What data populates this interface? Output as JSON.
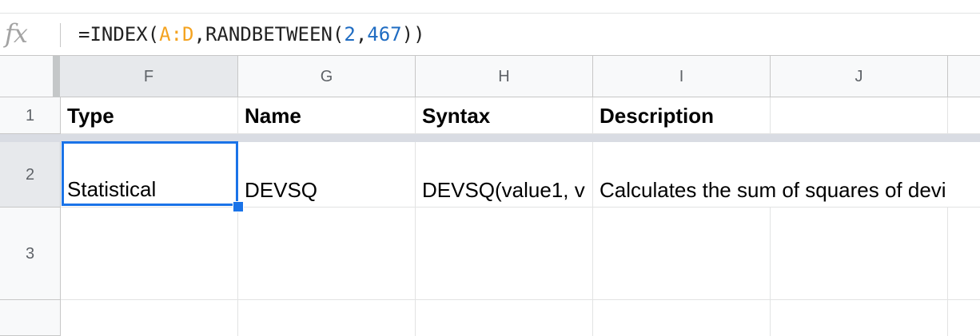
{
  "formula_bar": {
    "fx_label": "fx",
    "formula_prefix": "=INDEX(",
    "formula_range": "A:D",
    "formula_mid": ",RANDBETWEEN(",
    "formula_arg1": "2",
    "formula_comma": ",",
    "formula_arg2": "467",
    "formula_suffix": "))"
  },
  "columns": [
    "F",
    "G",
    "H",
    "I",
    "J"
  ],
  "rows": [
    "1",
    "2",
    "3"
  ],
  "header_row": {
    "F": "Type",
    "G": "Name",
    "H": "Syntax",
    "I": "Description",
    "J": ""
  },
  "row2": {
    "F": "Statistical",
    "G": "DEVSQ",
    "H": "DEVSQ(value1, v",
    "I": "Calculates the sum of squares of devi"
  },
  "colors": {
    "selection": "#1a73e8",
    "range_ref": "#f4a320",
    "number_ref": "#1f6cc2"
  }
}
